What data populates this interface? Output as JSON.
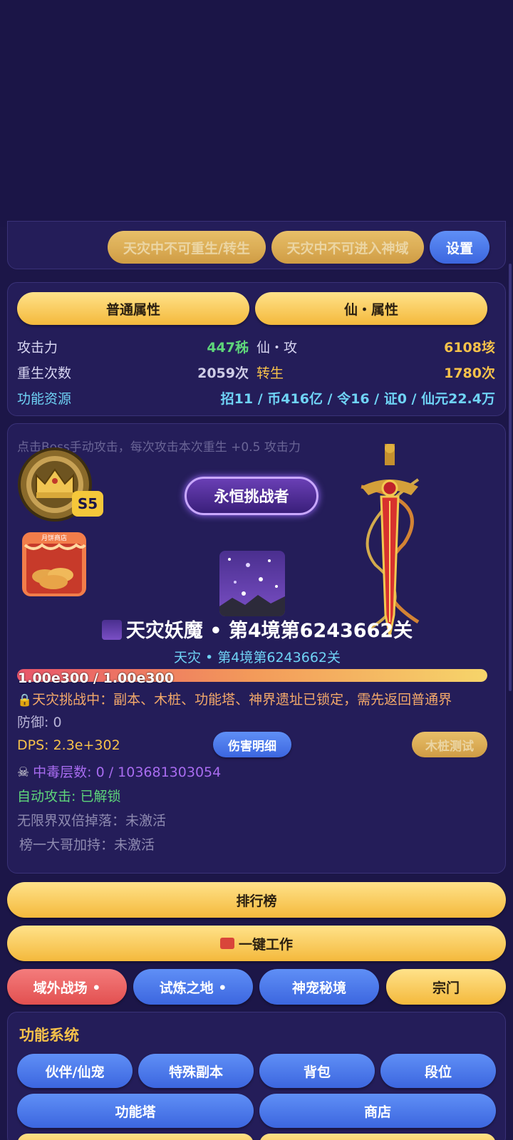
{
  "top_panel": {
    "rebirth_disabled_label": "天灾中不可重生/转生",
    "divine_disabled_label": "天灾中不可进入神域",
    "settings_label": "设置"
  },
  "attributes": {
    "tab_normal": "普通属性",
    "tab_immortal": "仙・属性",
    "attack_label": "攻击力",
    "attack_value": "447秭",
    "immortal_attack_label": "仙・攻",
    "immortal_attack_value": "6108垓",
    "rebirth_count_label": "重生次数",
    "rebirth_count_value": "2059次",
    "reincarnation_label": "转生",
    "reincarnation_value": "1780次",
    "resources_label": "功能资源",
    "resources_value": "招11 / 币416亿 / 令16 / 证0 / 仙元22.4万"
  },
  "battle": {
    "hint": "点击Boss手动攻击，每次攻击本次重生 +0.5 攻击力",
    "season_badge": "S5",
    "shop_sign": "月饼商店",
    "challenger_title": "永恒挑战者",
    "boss_name": "天灾妖魔 • 第4境第6243662关",
    "stage_subtitle": "天灾 • 第4境第6243662关",
    "hp_text": "1.00e300 / 1.00e300",
    "hp_fraction": 1.0,
    "lock_notice": "天灾挑战中：副本、木桩、功能塔、神界遗址已锁定，需先返回普通界",
    "defense": "防御: 0",
    "dps": "DPS: 2.3e+302",
    "damage_detail_label": "伤害明细",
    "dummy_test_label": "木桩测试",
    "poison": "中毒层数: 0 / 103681303054",
    "auto_attack": "自动攻击: 已解锁",
    "double_drop": "无限界双倍掉落：未激活",
    "rank_boost": "榜一大哥加持：未激活"
  },
  "actions": {
    "leaderboard": "排行榜",
    "one_click_work": "一键工作",
    "outer_battlefield": "域外战场 •",
    "trial_land": "试炼之地 •",
    "pet_realm": "神宠秘境",
    "sect": "宗门"
  },
  "functions": {
    "title": "功能系统",
    "items": [
      "伙伴/仙宠",
      "特殊副本",
      "背包",
      "段位"
    ],
    "items2": [
      "功能塔",
      "商店"
    ]
  },
  "colors": {
    "background": "#1c1648",
    "panel": "#241d59",
    "gold": "#f4b93c",
    "blue": "#3c66df",
    "red": "#e25050",
    "green": "#5ed67a",
    "cyan": "#6fd3f5"
  }
}
